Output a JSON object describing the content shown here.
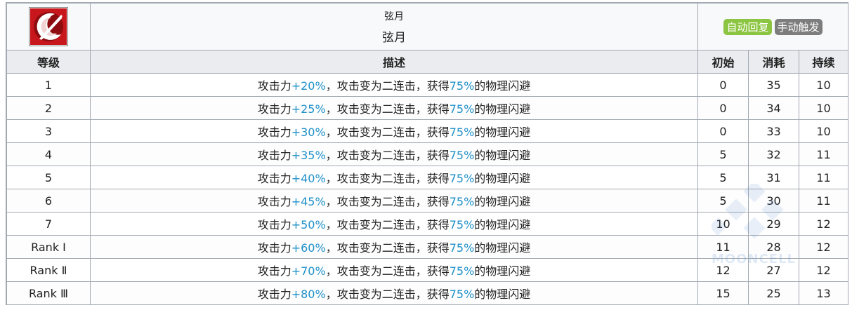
{
  "skill": {
    "name_top": "弦月",
    "name_main": "弦月",
    "badges": [
      "自动回复",
      "手动触发"
    ],
    "icon": "crescent-slash-icon"
  },
  "columns": [
    "等级",
    "描述",
    "初始",
    "消耗",
    "持续"
  ],
  "rows": [
    {
      "level": "1",
      "desc_a": "攻击力",
      "atk": "+20%",
      "desc_b": "，攻击变为二连击，获得",
      "dodge": "75%",
      "desc_c": "的物理闪避",
      "init": "0",
      "cost": "35",
      "dur": "10"
    },
    {
      "level": "2",
      "desc_a": "攻击力",
      "atk": "+25%",
      "desc_b": "，攻击变为二连击，获得",
      "dodge": "75%",
      "desc_c": "的物理闪避",
      "init": "0",
      "cost": "34",
      "dur": "10"
    },
    {
      "level": "3",
      "desc_a": "攻击力",
      "atk": "+30%",
      "desc_b": "，攻击变为二连击，获得",
      "dodge": "75%",
      "desc_c": "的物理闪避",
      "init": "0",
      "cost": "33",
      "dur": "10"
    },
    {
      "level": "4",
      "desc_a": "攻击力",
      "atk": "+35%",
      "desc_b": "，攻击变为二连击，获得",
      "dodge": "75%",
      "desc_c": "的物理闪避",
      "init": "5",
      "cost": "32",
      "dur": "11"
    },
    {
      "level": "5",
      "desc_a": "攻击力",
      "atk": "+40%",
      "desc_b": "，攻击变为二连击，获得",
      "dodge": "75%",
      "desc_c": "的物理闪避",
      "init": "5",
      "cost": "31",
      "dur": "11"
    },
    {
      "level": "6",
      "desc_a": "攻击力",
      "atk": "+45%",
      "desc_b": "，攻击变为二连击，获得",
      "dodge": "75%",
      "desc_c": "的物理闪避",
      "init": "5",
      "cost": "30",
      "dur": "11"
    },
    {
      "level": "7",
      "desc_a": "攻击力",
      "atk": "+50%",
      "desc_b": "，攻击变为二连击，获得",
      "dodge": "75%",
      "desc_c": "的物理闪避",
      "init": "10",
      "cost": "29",
      "dur": "12"
    },
    {
      "level": "Rank Ⅰ",
      "desc_a": "攻击力",
      "atk": "+60%",
      "desc_b": "，攻击变为二连击，获得",
      "dodge": "75%",
      "desc_c": "的物理闪避",
      "init": "11",
      "cost": "28",
      "dur": "12"
    },
    {
      "level": "Rank Ⅱ",
      "desc_a": "攻击力",
      "atk": "+70%",
      "desc_b": "，攻击变为二连击，获得",
      "dodge": "75%",
      "desc_c": "的物理闪避",
      "init": "12",
      "cost": "27",
      "dur": "12"
    },
    {
      "level": "Rank Ⅲ",
      "desc_a": "攻击力",
      "atk": "+80%",
      "desc_b": "，攻击变为二连击，获得",
      "dodge": "75%",
      "desc_c": "的物理闪避",
      "init": "15",
      "cost": "25",
      "dur": "13"
    }
  ],
  "watermark": "MOONCELL",
  "colors": {
    "highlight": "#1e90c8",
    "badge_auto": "#8cc541",
    "badge_manual": "#7d7d7d",
    "icon_red": "#c8161d"
  }
}
